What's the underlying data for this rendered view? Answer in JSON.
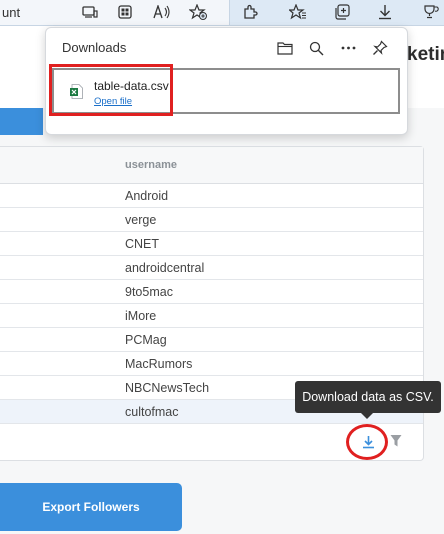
{
  "browser": {
    "address_tail": "unt",
    "icons": [
      "reading-view-icon",
      "apps-icon",
      "read-aloud-icon",
      "add-favorite-icon",
      "extensions-icon",
      "favorites-icon",
      "collections-icon",
      "downloads-icon",
      "browser-essentials-icon"
    ]
  },
  "downloads": {
    "title": "Downloads",
    "file_name": "table-data.csv",
    "open_label": "Open file"
  },
  "page": {
    "header_clip": "keting"
  },
  "table": {
    "column_header": "username",
    "rows": [
      "Android",
      "verge",
      "CNET",
      "androidcentral",
      "9to5mac",
      "iMore",
      "PCMag",
      "MacRumors",
      "NBCNewsTech",
      "cultofmac"
    ]
  },
  "tooltip": "Download data as CSV.",
  "export_button": "Export Followers",
  "colors": {
    "accent": "#3b8fdc",
    "highlight": "#e02020"
  }
}
